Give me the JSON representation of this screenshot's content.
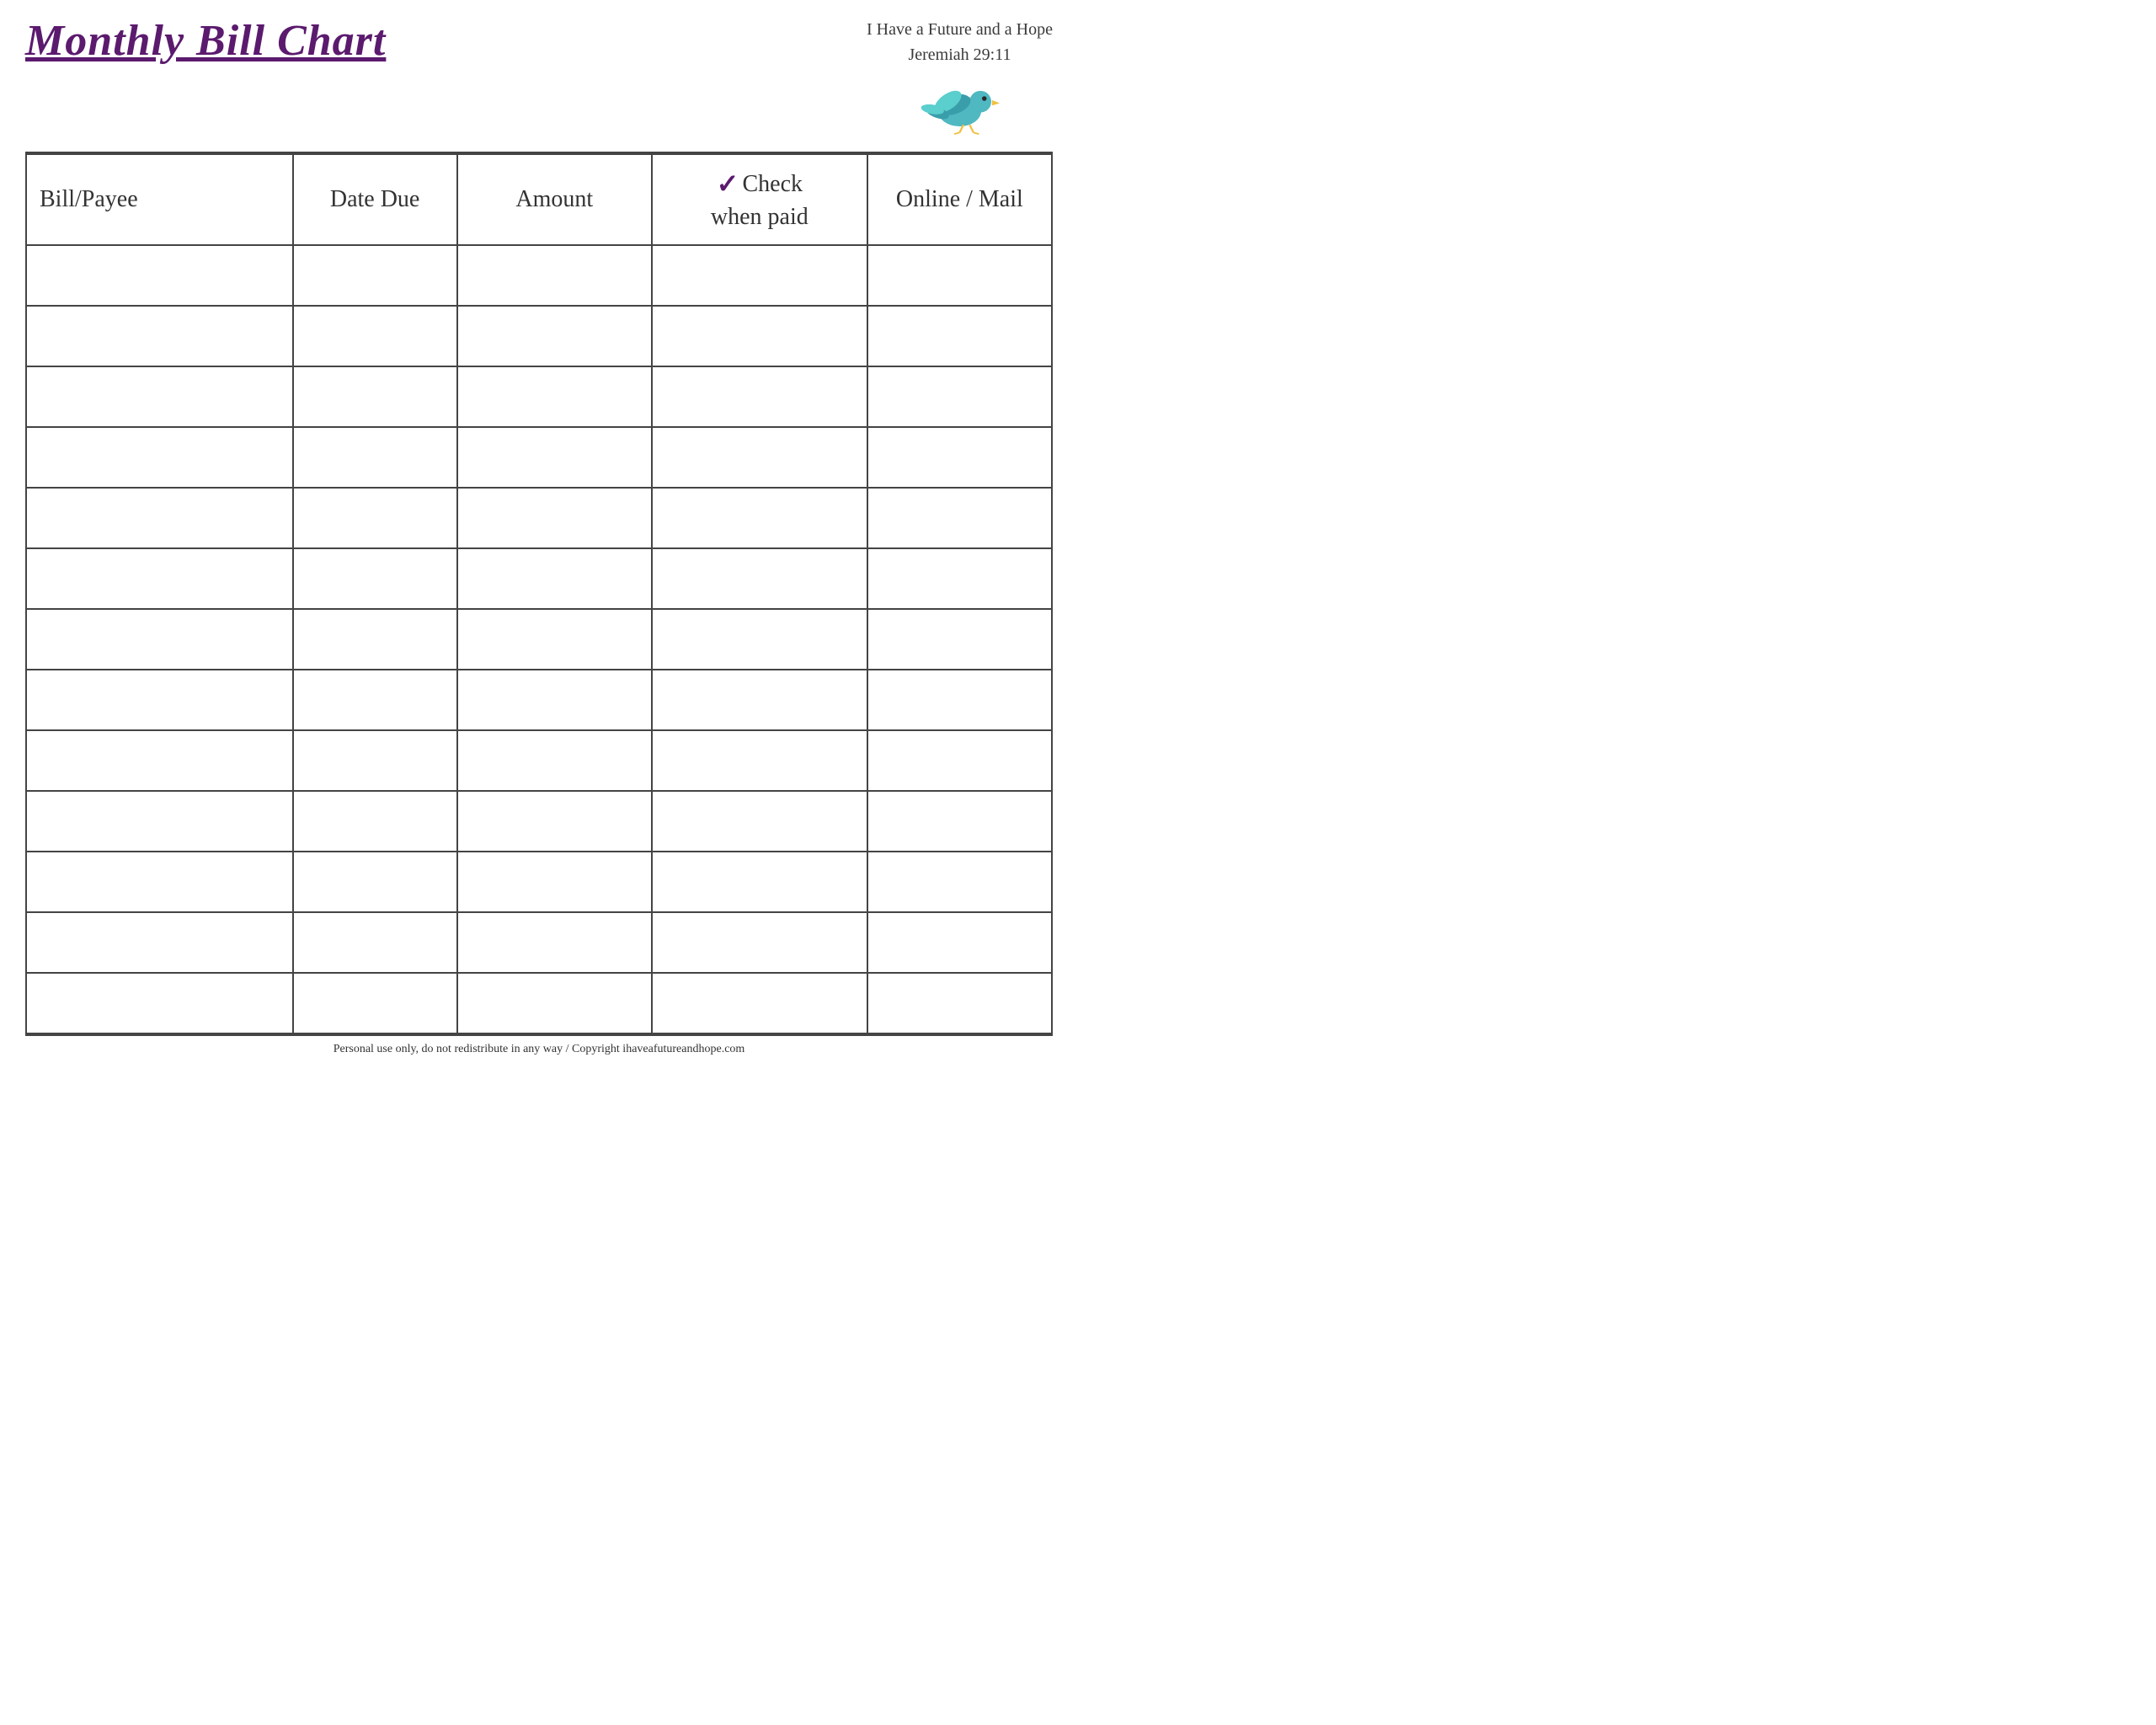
{
  "header": {
    "title": "Monthly Bill Chart",
    "scripture_line1": "I Have a Future and a Hope",
    "scripture_line2": "Jeremiah 29:11"
  },
  "table": {
    "columns": [
      {
        "id": "bill",
        "label": "Bill/Payee"
      },
      {
        "id": "date",
        "label": "Date Due"
      },
      {
        "id": "amount",
        "label": "Amount"
      },
      {
        "id": "check",
        "label_line1": "Check",
        "label_line2": "when paid"
      },
      {
        "id": "online",
        "label": "Online / Mail"
      }
    ],
    "row_count": 13
  },
  "footer": {
    "text": "Personal use only, do not redistribute in any way / Copyright ihaveafutureandhope.com"
  }
}
